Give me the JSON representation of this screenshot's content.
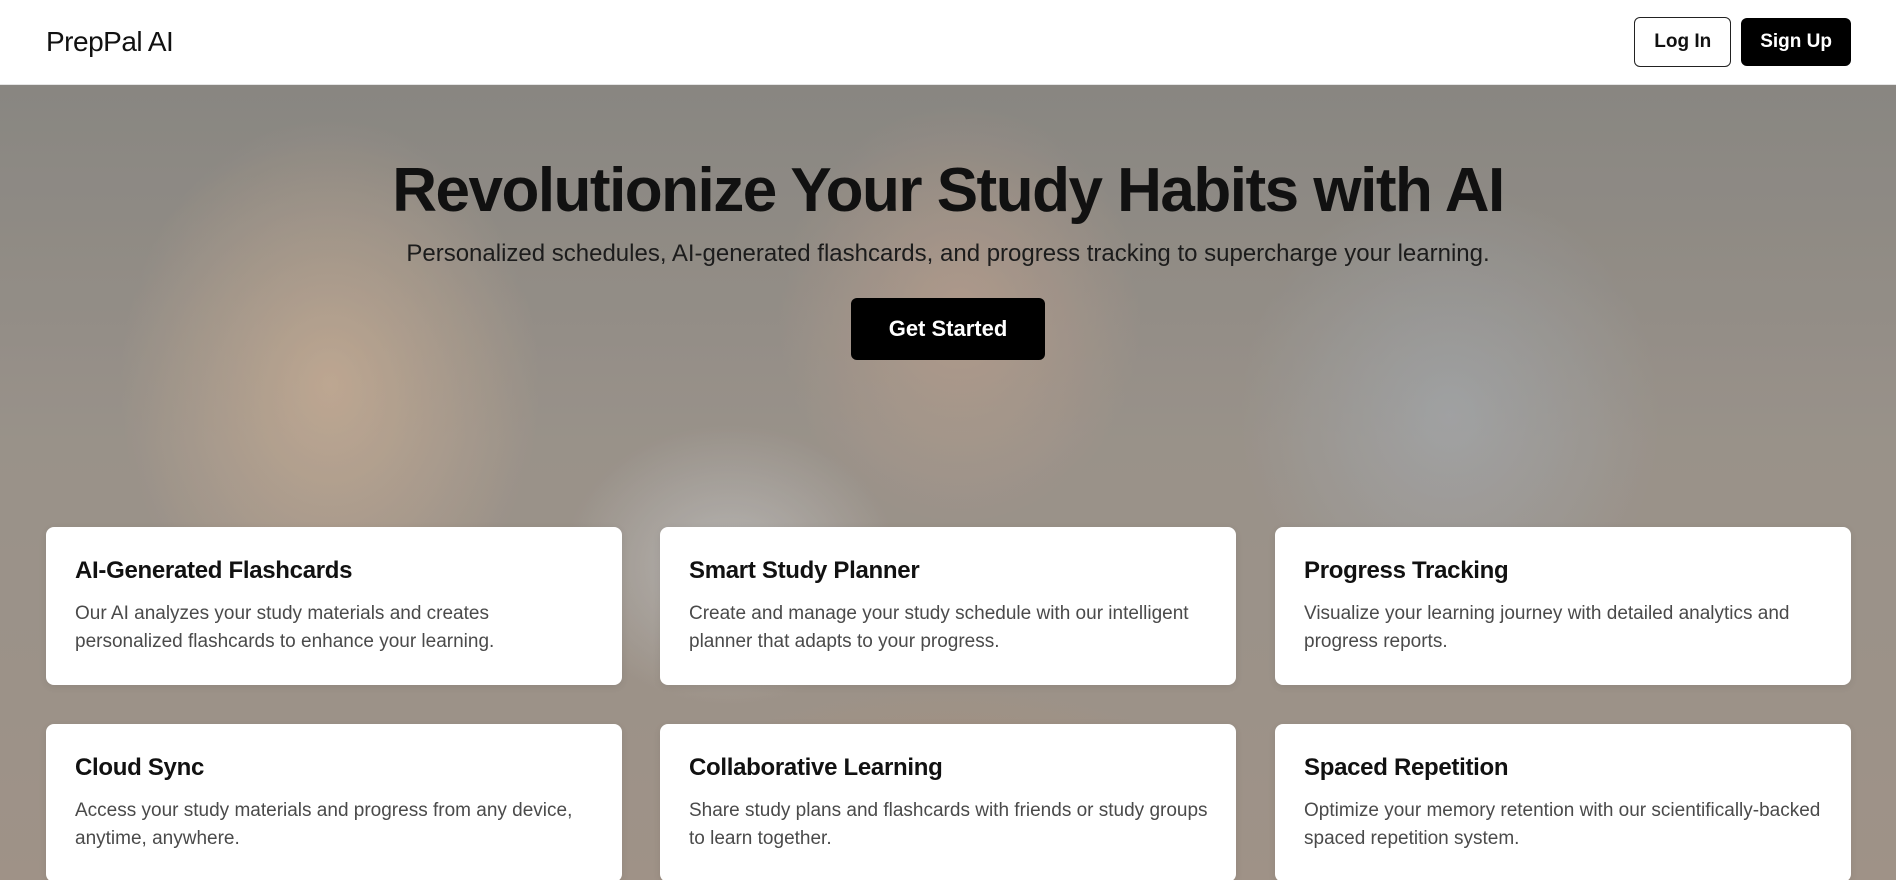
{
  "header": {
    "brand": "PrepPal AI",
    "login_label": "Log In",
    "signup_label": "Sign Up"
  },
  "hero": {
    "title": "Revolutionize Your Study Habits with AI",
    "subtitle": "Personalized schedules, AI-generated flashcards, and progress tracking to supercharge your learning.",
    "cta_label": "Get Started"
  },
  "features": [
    {
      "title": "AI-Generated Flashcards",
      "description": "Our AI analyzes your study materials and creates personalized flashcards to enhance your learning."
    },
    {
      "title": "Smart Study Planner",
      "description": "Create and manage your study schedule with our intelligent planner that adapts to your progress."
    },
    {
      "title": "Progress Tracking",
      "description": "Visualize your learning journey with detailed analytics and progress reports."
    },
    {
      "title": "Cloud Sync",
      "description": "Access your study materials and progress from any device, anytime, anywhere."
    },
    {
      "title": "Collaborative Learning",
      "description": "Share study plans and flashcards with friends or study groups to learn together."
    },
    {
      "title": "Spaced Repetition",
      "description": "Optimize your memory retention with our scientifically-backed spaced repetition system."
    }
  ],
  "colors": {
    "primary": "#000000",
    "background": "#ffffff",
    "text": "#111111",
    "muted_text": "#4a4a4a"
  }
}
